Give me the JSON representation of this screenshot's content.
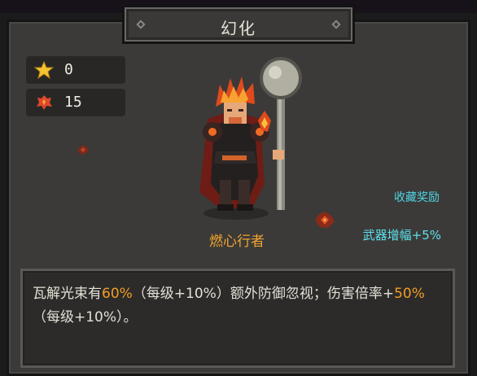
{
  "title": "幻化",
  "counters": {
    "star_value": "0",
    "ember_value": "15"
  },
  "hero": {
    "name": "燃心行者"
  },
  "collection_reward_label": "收藏奖励",
  "weapon_bonus": "武器增幅+5%",
  "description": {
    "part1": "瓦解光束有",
    "value1": "60%",
    "part2": "（每级+10%）额外防御忽视；伤害倍率+",
    "value2": "50%",
    "part3": "（每级+10%）。"
  },
  "colors": {
    "accent_orange": "#f29c24",
    "accent_cyan": "#4fd6e6",
    "panel": "#3b3a38"
  },
  "icons": {
    "star": "star-icon",
    "ember": "ember-icon"
  }
}
